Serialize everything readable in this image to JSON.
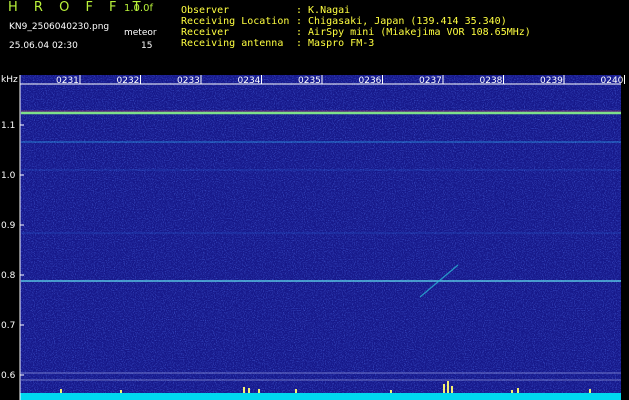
{
  "header": {
    "logo": "H R O F F T",
    "version": "1.0.0f",
    "filename": "KN9_2506040230.png",
    "meteor_label": "meteor",
    "count": "15",
    "datetime": "25.06.04 02:30",
    "info_labels": [
      "Observer",
      "Receiving Location",
      "Receiver",
      "Receiving antenna"
    ],
    "info_values": [
      ": K.Nagai",
      ": Chigasaki, Japan (139.414 35.340)",
      ": AirSpy mini (Miakejima VOR 108.65MHz)",
      ": Maspro FM-3"
    ]
  },
  "axes": {
    "y_unit": "kHz",
    "y_ticks": [
      "1.1",
      "1.0",
      "0.9",
      "0.8",
      "0.7",
      "0.6"
    ],
    "y_values": [
      1.1,
      1.0,
      0.9,
      0.8,
      0.7,
      0.6
    ],
    "x_ticks": [
      "0231",
      "0232",
      "0233",
      "0234",
      "0235",
      "0236",
      "0237",
      "0238",
      "0239",
      "0240"
    ]
  },
  "colors": {
    "bg": "#000000",
    "spectrum": "#16188a",
    "text": "#ffffff",
    "label": "#ffff40",
    "logo": "#b9f23a",
    "baseline": "#00e5ff"
  }
}
